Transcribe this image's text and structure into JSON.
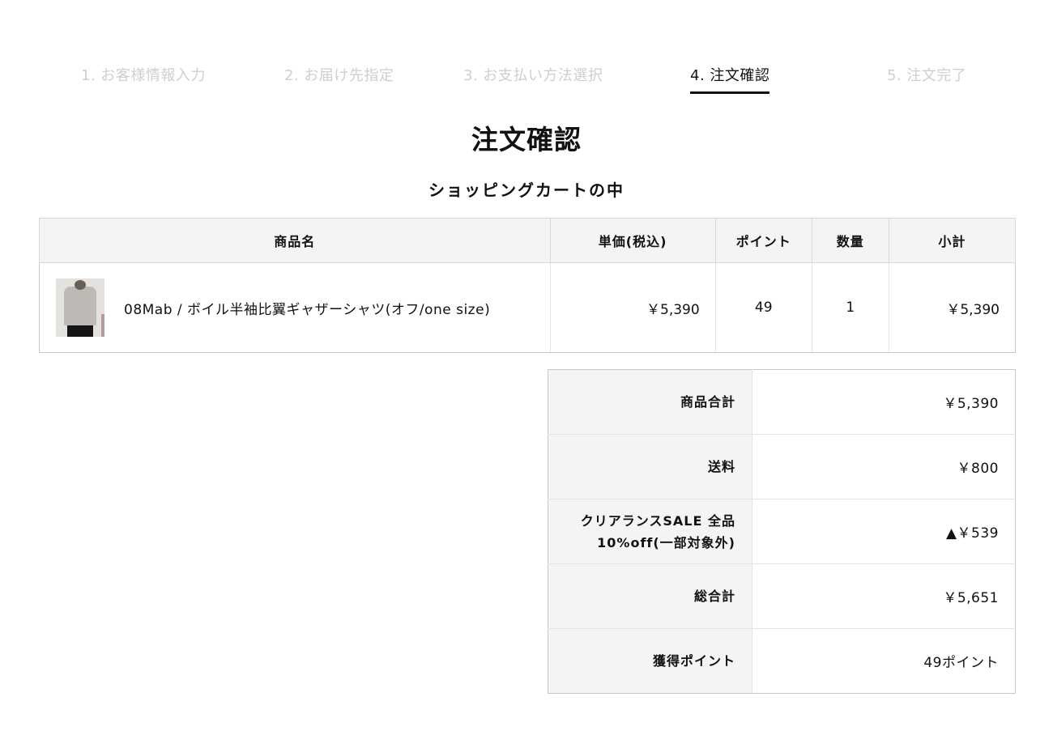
{
  "steps": [
    {
      "label": "1. お客様情報入力",
      "state": "inactive"
    },
    {
      "label": "2. お届け先指定",
      "state": "inactive"
    },
    {
      "label": "3. お支払い方法選択",
      "state": "inactive"
    },
    {
      "label": "4. 注文確認",
      "state": "active"
    },
    {
      "label": "5. 注文完了",
      "state": "inactive"
    }
  ],
  "page_title": "注文確認",
  "cart": {
    "section_title": "ショッピングカートの中",
    "headers": {
      "name": "商品名",
      "unit_price": "単価(税込)",
      "points": "ポイント",
      "quantity": "数量",
      "subtotal": "小計"
    },
    "items": [
      {
        "image_icon": "product-thumbnail",
        "name": "08Mab / ボイル半袖比翼ギャザーシャツ(オフ/one size)",
        "unit_price": "￥5,390",
        "points": "49",
        "quantity": "1",
        "subtotal": "￥5,390"
      }
    ]
  },
  "summary": [
    {
      "label": "商品合計",
      "value": "￥5,390"
    },
    {
      "label": "送料",
      "value": "￥800"
    },
    {
      "label": "クリアランスSALE 全品\n10%off(一部対象外)",
      "value": "▲￥539"
    },
    {
      "label": "総合計",
      "value": "￥5,651"
    },
    {
      "label": "獲得ポイント",
      "value": "49ポイント"
    }
  ],
  "colors": {
    "active_step": "#111111",
    "inactive_step": "#cfcfcf",
    "header_background": "#f4f4f4",
    "border": "#c8c8c8"
  }
}
